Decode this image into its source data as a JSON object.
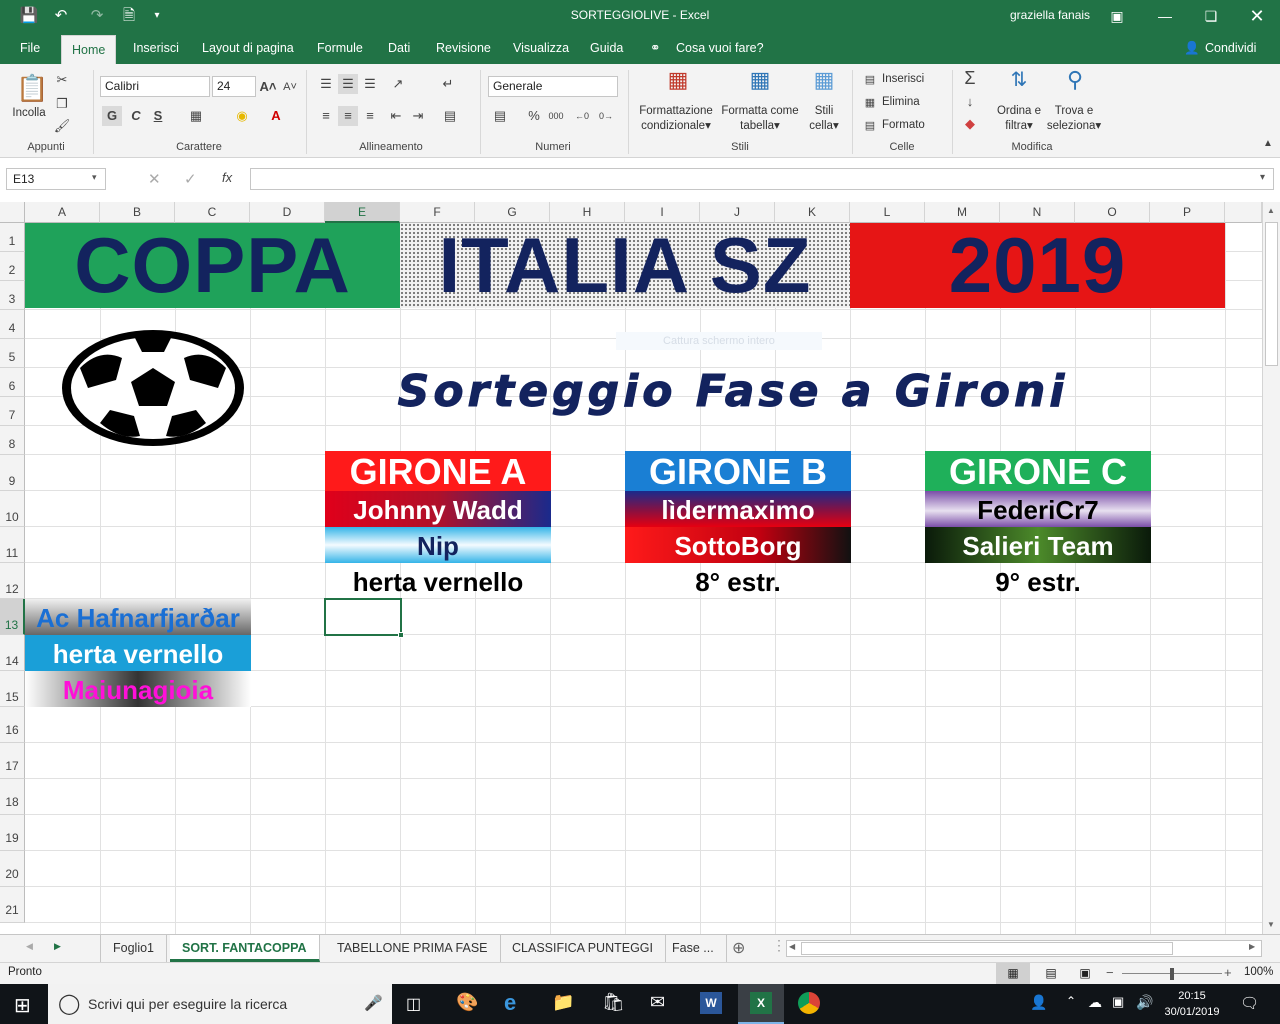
{
  "window": {
    "title": "SORTEGGIOLIVE  -  Excel",
    "user": "graziella fanais"
  },
  "menu": {
    "tabs": [
      "File",
      "Home",
      "Inserisci",
      "Layout di pagina",
      "Formule",
      "Dati",
      "Revisione",
      "Visualizza",
      "Guida"
    ],
    "tell_me": "Cosa vuoi fare?",
    "share": "Condividi"
  },
  "ribbon": {
    "paste_label": "Incolla",
    "font_name": "Calibri",
    "font_size": "24",
    "bold": "G",
    "italic": "C",
    "underline": "S",
    "number_format": "Generale",
    "conditional_format": [
      "Formattazione",
      "condizionale"
    ],
    "format_table": [
      "Formatta come",
      "tabella"
    ],
    "cell_styles": [
      "Stili",
      "cella"
    ],
    "insert": "Inserisci",
    "delete": "Elimina",
    "format": "Formato",
    "sort_filter": [
      "Ordina e",
      "filtra"
    ],
    "find_select": [
      "Trova e",
      "seleziona"
    ],
    "groups": [
      "Appunti",
      "Carattere",
      "Allineamento",
      "Numeri",
      "Stili",
      "Celle",
      "Modifica"
    ]
  },
  "formula_bar": {
    "name_box": "E13",
    "fx": "fx",
    "content": ""
  },
  "grid": {
    "columns": [
      "A",
      "B",
      "C",
      "D",
      "E",
      "F",
      "G",
      "H",
      "I",
      "J",
      "K",
      "L",
      "M",
      "N",
      "O",
      "P"
    ],
    "rows": [
      "1",
      "2",
      "3",
      "4",
      "5",
      "6",
      "7",
      "8",
      "9",
      "10",
      "11",
      "12",
      "13",
      "14",
      "15",
      "16",
      "17",
      "18",
      "19",
      "20",
      "21"
    ]
  },
  "sheet": {
    "banner_left": "COPPA",
    "banner_mid": "ITALIA SZ",
    "banner_right": "2019",
    "subtitle": "Sorteggio Fase a Gironi",
    "overlay_hint": "Cattura schermo intero",
    "group_a": {
      "title": "GIRONE A",
      "teams": [
        "Johnny Wadd",
        "Nip",
        "herta vernello"
      ]
    },
    "group_b": {
      "title": "GIRONE B",
      "teams": [
        "lìdermaximo",
        "SottoBorg",
        "8° estr."
      ]
    },
    "group_c": {
      "title": "GIRONE C",
      "teams": [
        "FederiCr7",
        "Salieri Team",
        "9° estr."
      ]
    },
    "pool": [
      "Ac Hafnarfjarðar",
      "herta vernello",
      "Maiunagioia"
    ]
  },
  "sheet_tabs": [
    "Foglio1",
    "SORT. FANTACOPPA",
    "TABELLONE PRIMA FASE",
    "CLASSIFICA PUNTEGGI",
    "Fase ..."
  ],
  "status": {
    "ready": "Pronto",
    "zoom": "100%"
  },
  "taskbar": {
    "search_placeholder": "Scrivi qui per eseguire la ricerca",
    "time": "20:15",
    "date": "30/01/2019"
  },
  "colors": {
    "excel_green": "#217346",
    "banner_text": "#13235e",
    "group_a": "#ff1a1a",
    "group_b": "#1a7fd4",
    "group_c": "#1fb05a"
  }
}
